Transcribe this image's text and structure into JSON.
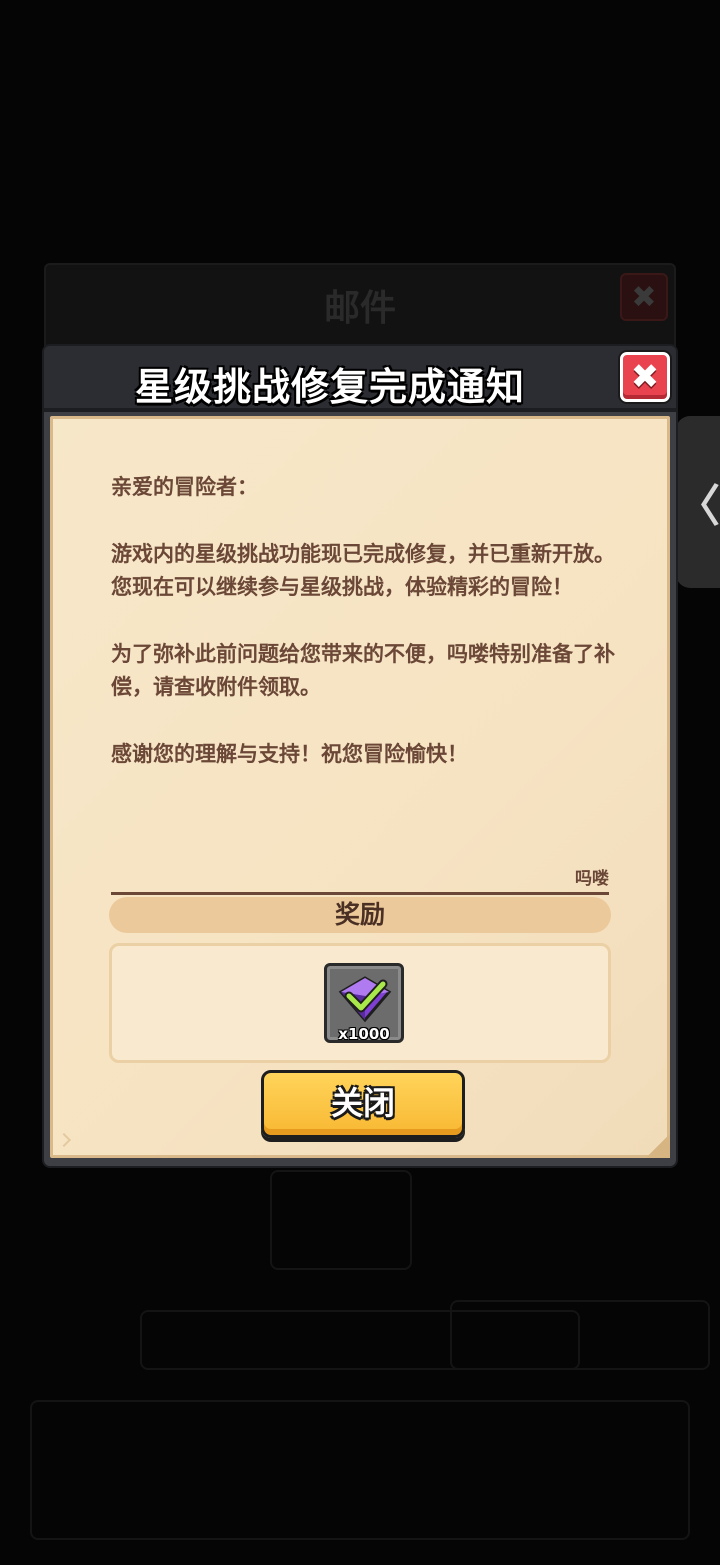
{
  "background": {
    "mail_window_title": "邮件",
    "mail_close_label": "✖"
  },
  "side_tab": {
    "icon": "chevron-left-icon",
    "glyph": "〈"
  },
  "dialog": {
    "title": "星级挑战修复完成通知",
    "close_glyph": "✖",
    "letter": {
      "greeting": "亲爱的冒险者：",
      "paragraphs": [
        "游戏内的星级挑战功能现已完成修复，并已重新开放。您现在可以继续参与星级挑战，体验精彩的冒险！",
        "为了弥补此前问题给您带来的不便，吗喽特别准备了补偿，请查收附件领取。",
        "感谢您的理解与支持！祝您冒险愉快！"
      ],
      "signature": "吗喽"
    },
    "reward": {
      "label": "奖励",
      "items": [
        {
          "icon": "purple-gem-icon",
          "quantity": "x1000"
        }
      ]
    },
    "close_button": "关闭"
  },
  "colors": {
    "paper": "#f7e7c9",
    "text": "#6b4737",
    "close_red": "#e8434f",
    "button_yellow": "#f8b833"
  }
}
